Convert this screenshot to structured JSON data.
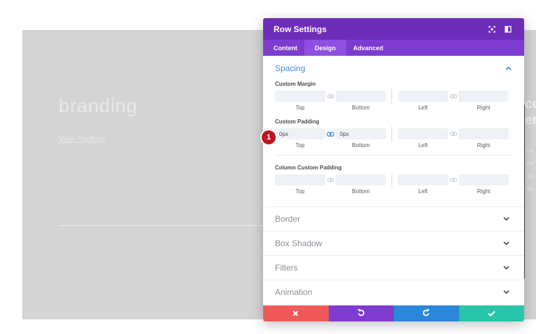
{
  "background": {
    "title": "branding",
    "link": "View Portfolio",
    "right_heading": "co er",
    "right_text": "l in yle ntu de"
  },
  "modal": {
    "title": "Row Settings",
    "tabs": [
      {
        "label": "Content",
        "active": false
      },
      {
        "label": "Design",
        "active": true
      },
      {
        "label": "Advanced",
        "active": false
      }
    ],
    "spacing": {
      "title": "Spacing",
      "custom_margin": {
        "label": "Custom Margin",
        "values": [
          "",
          "",
          "",
          ""
        ],
        "linked": [
          false,
          false
        ]
      },
      "custom_padding": {
        "label": "Custom Padding",
        "values": [
          "0px",
          "0px",
          "",
          ""
        ],
        "linked": [
          true,
          false
        ]
      },
      "column_custom_padding": {
        "label": "Column Custom Padding",
        "values": [
          "",
          "",
          "",
          ""
        ],
        "linked": [
          false,
          false
        ]
      },
      "captions": [
        "Top",
        "Bottom",
        "Left",
        "Right"
      ]
    },
    "groups": [
      "Border",
      "Box Shadow",
      "Filters",
      "Animation"
    ],
    "badge": "1"
  },
  "colors": {
    "header": "#6c2eb9",
    "tabs": "#7e3bd0",
    "accent": "#3a8ed8",
    "cancel": "#ef5a59",
    "undo": "#7e3bd0",
    "redo": "#2b87da",
    "save": "#29c4a9",
    "badge": "#c0141c"
  },
  "icons": {
    "expand": "expand-icon",
    "sidebar": "sidebar-toggle-icon",
    "link": "link-icon",
    "chevron_up": "chevron-up-icon",
    "chevron_down": "chevron-down-icon",
    "cancel": "close-icon",
    "undo": "undo-icon",
    "redo": "redo-icon",
    "save": "check-icon"
  }
}
